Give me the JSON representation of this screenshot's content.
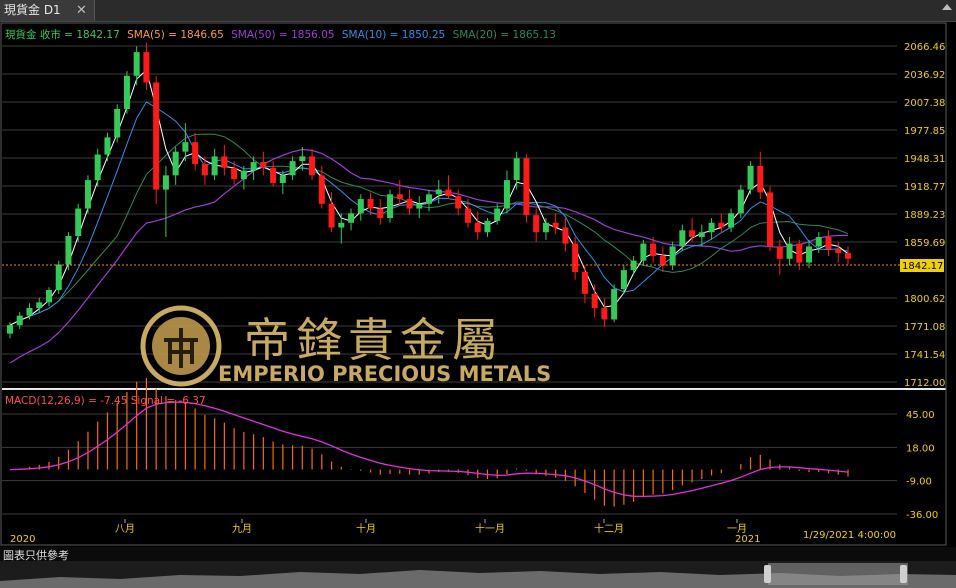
{
  "tab": {
    "title": "現貨金 D1",
    "close_glyph": "✕"
  },
  "legend": {
    "close": {
      "label": "現貨金 收市",
      "value": "1842.17",
      "color": "#35c95a"
    },
    "sma5": {
      "label": "SMA(5)",
      "value": "1846.65",
      "color": "#ff9a3c"
    },
    "sma50": {
      "label": "SMA(50)",
      "value": "1856.05",
      "color": "#9b3dd6"
    },
    "sma10": {
      "label": "SMA(10)",
      "value": "1850.25",
      "color": "#2f8fe8"
    },
    "sma20": {
      "label": "SMA(20)",
      "value": "1865.13",
      "color": "#2e8b57"
    }
  },
  "price_axis": {
    "ticks": [
      "2066.46",
      "2036.92",
      "2007.38",
      "1977.85",
      "1948.31",
      "1918.77",
      "1889.23",
      "1859.69",
      "1800.62",
      "1771.08",
      "1741.54",
      "1712.00"
    ],
    "current": "1842.17"
  },
  "macd_legend": {
    "macd_label": "MACD(12,26,9)",
    "macd_value": "-7.45",
    "signal_label": "Signal",
    "signal_value": "-6.37",
    "color": "#ff4d4d"
  },
  "macd_axis": {
    "ticks": [
      "45.00",
      "18.00",
      "-9.00",
      "-36.00"
    ]
  },
  "time_axis": {
    "labels": [
      "2020",
      "八月",
      "九月",
      "十月",
      "十一月",
      "十二月",
      "一月",
      "2021",
      "1/29/2021 4:00:00"
    ]
  },
  "logo": {
    "chinese": "帝鋒貴金屬",
    "english": "EMPERIO PRECIOUS METALS"
  },
  "footer_note": "圖表只供參考",
  "colors": {
    "up_candle": "#35c95a",
    "down_candle": "#ff1a1a",
    "axis_text": "#f0d000",
    "grid": "#3c3c3c",
    "macd_hist": "#ff6a00",
    "signal": "#e030e0",
    "logo": "#d9b86a"
  },
  "chart_data": {
    "type": "candlestick",
    "price_range": [
      1712.0,
      2066.46
    ],
    "macd_range": [
      -36,
      45
    ],
    "candle_ohlc_sample": [
      [
        1763,
        1775,
        1758,
        1772
      ],
      [
        1772,
        1786,
        1768,
        1782
      ],
      [
        1782,
        1795,
        1778,
        1790
      ],
      [
        1790,
        1801,
        1785,
        1796
      ],
      [
        1796,
        1812,
        1792,
        1809
      ],
      [
        1809,
        1840,
        1805,
        1836
      ],
      [
        1836,
        1870,
        1830,
        1866
      ],
      [
        1866,
        1900,
        1860,
        1895
      ],
      [
        1895,
        1930,
        1890,
        1925
      ],
      [
        1925,
        1958,
        1918,
        1952
      ],
      [
        1952,
        1975,
        1945,
        1970
      ],
      [
        1970,
        2005,
        1965,
        2000
      ],
      [
        2000,
        2040,
        1995,
        2035
      ],
      [
        2035,
        2066,
        2025,
        2060
      ],
      [
        2060,
        2070,
        2020,
        2028
      ],
      [
        2028,
        2035,
        1900,
        1915
      ],
      [
        1915,
        1940,
        1865,
        1930
      ],
      [
        1930,
        1960,
        1920,
        1955
      ],
      [
        1955,
        1985,
        1945,
        1965
      ],
      [
        1965,
        1975,
        1935,
        1942
      ],
      [
        1942,
        1950,
        1920,
        1930
      ],
      [
        1930,
        1958,
        1925,
        1950
      ],
      [
        1950,
        1962,
        1930,
        1938
      ],
      [
        1938,
        1945,
        1920,
        1926
      ],
      [
        1926,
        1940,
        1915,
        1935
      ],
      [
        1935,
        1950,
        1925,
        1944
      ],
      [
        1944,
        1955,
        1930,
        1938
      ],
      [
        1938,
        1945,
        1918,
        1922
      ],
      [
        1922,
        1935,
        1910,
        1930
      ],
      [
        1930,
        1950,
        1925,
        1945
      ],
      [
        1945,
        1960,
        1935,
        1950
      ],
      [
        1950,
        1958,
        1925,
        1930
      ],
      [
        1930,
        1940,
        1895,
        1900
      ],
      [
        1900,
        1912,
        1870,
        1875
      ],
      [
        1875,
        1890,
        1858,
        1880
      ],
      [
        1880,
        1895,
        1872,
        1890
      ],
      [
        1890,
        1910,
        1882,
        1905
      ],
      [
        1905,
        1912,
        1888,
        1895
      ],
      [
        1895,
        1905,
        1878,
        1885
      ],
      [
        1885,
        1915,
        1880,
        1910
      ],
      [
        1910,
        1925,
        1898,
        1905
      ],
      [
        1905,
        1915,
        1888,
        1895
      ],
      [
        1895,
        1908,
        1885,
        1900
      ],
      [
        1900,
        1915,
        1892,
        1910
      ],
      [
        1910,
        1925,
        1900,
        1915
      ],
      [
        1915,
        1930,
        1905,
        1908
      ],
      [
        1908,
        1915,
        1888,
        1895
      ],
      [
        1895,
        1905,
        1875,
        1880
      ],
      [
        1880,
        1892,
        1862,
        1870
      ],
      [
        1870,
        1885,
        1865,
        1882
      ],
      [
        1882,
        1900,
        1878,
        1895
      ],
      [
        1895,
        1935,
        1890,
        1925
      ],
      [
        1925,
        1955,
        1915,
        1948
      ],
      [
        1948,
        1952,
        1880,
        1888
      ],
      [
        1888,
        1895,
        1860,
        1870
      ],
      [
        1870,
        1885,
        1862,
        1880
      ],
      [
        1880,
        1890,
        1868,
        1875
      ],
      [
        1875,
        1885,
        1850,
        1858
      ],
      [
        1858,
        1865,
        1820,
        1828
      ],
      [
        1828,
        1835,
        1795,
        1805
      ],
      [
        1805,
        1815,
        1780,
        1790
      ],
      [
        1790,
        1800,
        1770,
        1778
      ],
      [
        1778,
        1815,
        1775,
        1810
      ],
      [
        1810,
        1835,
        1805,
        1830
      ],
      [
        1830,
        1845,
        1825,
        1840
      ],
      [
        1840,
        1862,
        1835,
        1858
      ],
      [
        1858,
        1865,
        1838,
        1845
      ],
      [
        1845,
        1855,
        1828,
        1835
      ],
      [
        1835,
        1860,
        1830,
        1855
      ],
      [
        1855,
        1878,
        1850,
        1872
      ],
      [
        1872,
        1885,
        1860,
        1865
      ],
      [
        1865,
        1878,
        1855,
        1870
      ],
      [
        1870,
        1885,
        1862,
        1880
      ],
      [
        1880,
        1890,
        1870,
        1875
      ],
      [
        1875,
        1895,
        1870,
        1890
      ],
      [
        1890,
        1920,
        1885,
        1915
      ],
      [
        1915,
        1945,
        1910,
        1940
      ],
      [
        1940,
        1955,
        1905,
        1912
      ],
      [
        1912,
        1918,
        1850,
        1855
      ],
      [
        1855,
        1862,
        1825,
        1842
      ],
      [
        1842,
        1865,
        1835,
        1858
      ],
      [
        1858,
        1862,
        1830,
        1838
      ],
      [
        1838,
        1862,
        1832,
        1855
      ],
      [
        1855,
        1870,
        1848,
        1865
      ],
      [
        1865,
        1872,
        1845,
        1852
      ],
      [
        1852,
        1860,
        1838,
        1848
      ],
      [
        1848,
        1855,
        1836,
        1842
      ]
    ]
  }
}
